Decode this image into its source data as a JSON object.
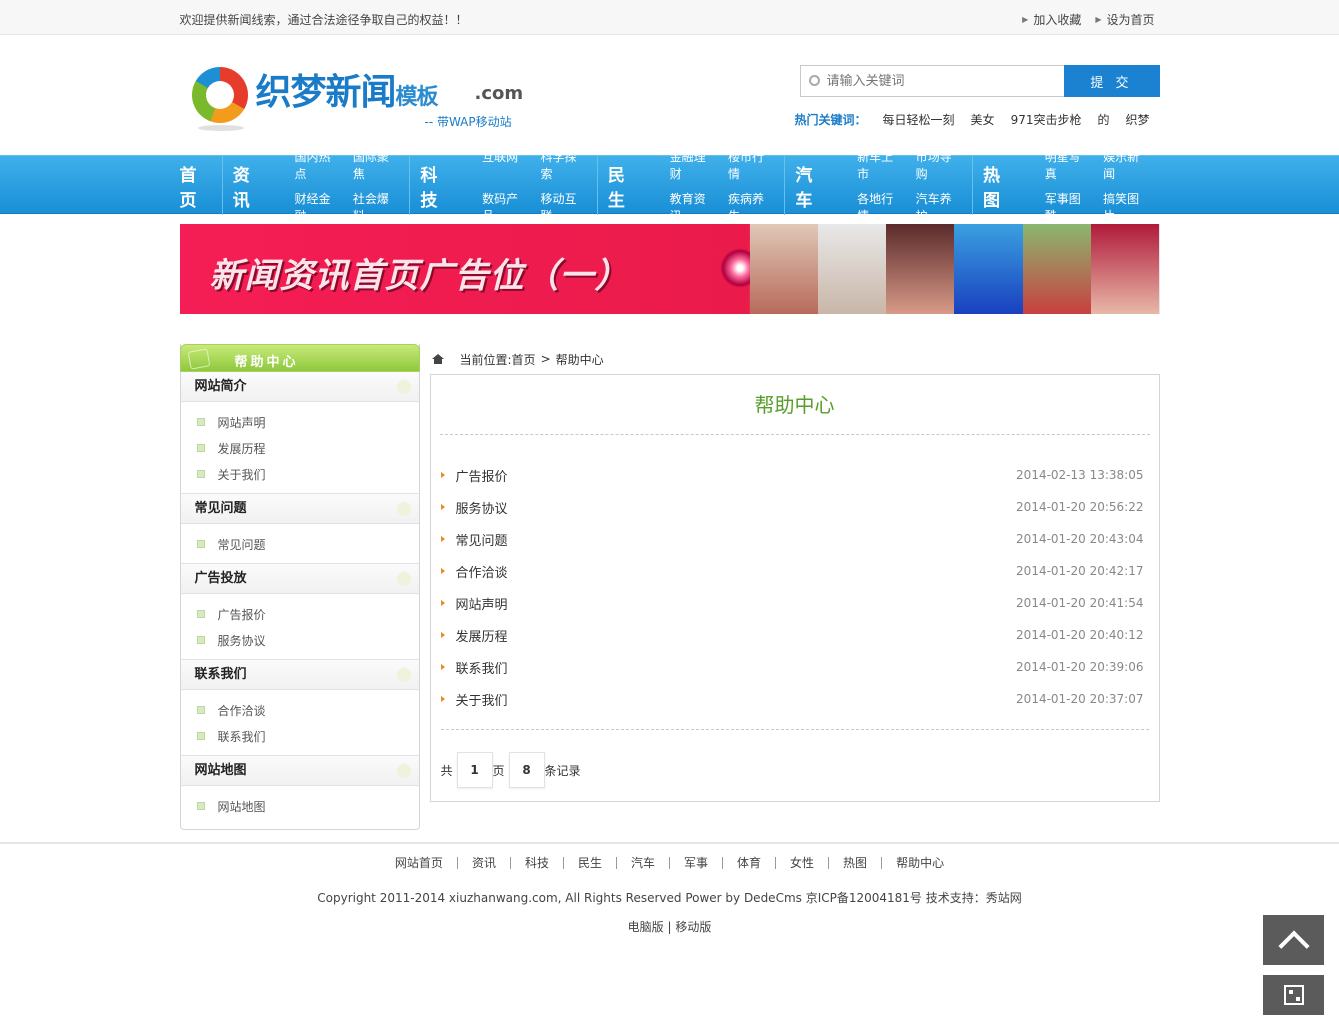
{
  "topbar": {
    "welcome": "欢迎提供新闻线索，通过合法途径争取自己的权益！！",
    "links": [
      "加入收藏",
      "设为首页"
    ]
  },
  "logo": {
    "brand": "织梦新闻",
    "suffix": "模板",
    "domain": ".com",
    "tagline": "-- 带WAP移动站"
  },
  "search": {
    "placeholder": "请输入关键词",
    "submit": "提 交"
  },
  "hot_keywords": {
    "label": "热门关键词：",
    "items": [
      "每日轻松一刻",
      "美女",
      "971突击步枪",
      "的",
      "织梦"
    ]
  },
  "nav": {
    "home": "首页",
    "groups": [
      {
        "title": "资讯",
        "subs": [
          "国内热点",
          "国际聚焦",
          "财经金融",
          "社会爆料"
        ]
      },
      {
        "title": "科技",
        "subs": [
          "互联网",
          "科学探索",
          "数码产品",
          "移动互联"
        ]
      },
      {
        "title": "民生",
        "subs": [
          "金融理财",
          "楼市行情",
          "教育资讯",
          "疾病养生"
        ]
      },
      {
        "title": "汽车",
        "subs": [
          "新车上市",
          "市场导购",
          "各地行情",
          "汽车养护"
        ]
      },
      {
        "title": "热图",
        "subs": [
          "明星写真",
          "娱乐新闻",
          "军事图酷",
          "搞笑图片"
        ]
      }
    ]
  },
  "banner": {
    "text": "新闻资讯首页广告位（一）"
  },
  "sidebar": {
    "title": "帮助中心",
    "sections": [
      {
        "title": "网站简介",
        "items": [
          "网站声明",
          "发展历程",
          "关于我们"
        ]
      },
      {
        "title": "常见问题",
        "items": [
          "常见问题"
        ]
      },
      {
        "title": "广告投放",
        "items": [
          "广告报价",
          "服务协议"
        ]
      },
      {
        "title": "联系我们",
        "items": [
          "合作洽谈",
          "联系我们"
        ]
      },
      {
        "title": "网站地图",
        "items": [
          "网站地图"
        ]
      }
    ]
  },
  "breadcrumb": {
    "label": "当前位置:",
    "home": "首页",
    "sep": ">",
    "current": "帮助中心"
  },
  "panel": {
    "title": "帮助中心",
    "items": [
      {
        "title": "广告报价",
        "date": "2014-02-13 13:38:05"
      },
      {
        "title": "服务协议",
        "date": "2014-01-20 20:56:22"
      },
      {
        "title": "常见问题",
        "date": "2014-01-20 20:43:04"
      },
      {
        "title": "合作洽谈",
        "date": "2014-01-20 20:42:17"
      },
      {
        "title": "网站声明",
        "date": "2014-01-20 20:41:54"
      },
      {
        "title": "发展历程",
        "date": "2014-01-20 20:40:12"
      },
      {
        "title": "联系我们",
        "date": "2014-01-20 20:39:06"
      },
      {
        "title": "关于我们",
        "date": "2014-01-20 20:37:07"
      }
    ]
  },
  "pager": {
    "prefix": "共",
    "pages": "1",
    "mid": "页",
    "records": "8",
    "suffix": "条记录"
  },
  "footer": {
    "links": [
      "网站首页",
      "资讯",
      "科技",
      "民生",
      "汽车",
      "军事",
      "体育",
      "女性",
      "热图",
      "帮助中心"
    ],
    "copyright": "Copyright 2011-2014 xiuzhanwang.com, All Rights Reserved Power by DedeCms 京ICP备12004181号  技术支持：秀站网",
    "modes": "电脑版 | 移动版"
  },
  "colors": {
    "nav_blue": "#1a8fd6",
    "accent_green": "#5a9e2a",
    "arrow_orange": "#e48b1a",
    "banner_pink": "#f51d55"
  }
}
